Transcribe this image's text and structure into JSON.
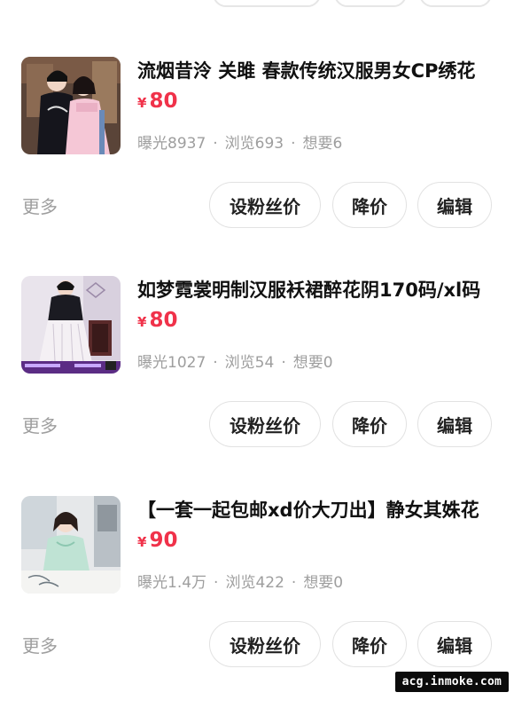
{
  "listings": [
    {
      "title": "流烟昔泠 关雎 春款传统汉服男女CP绣花",
      "currency": "¥",
      "price": "80",
      "stats": {
        "exposure": "曝光8937",
        "views": "浏览693",
        "wants": "想要6"
      },
      "more": "更多",
      "actions": {
        "fans_price": "设粉丝价",
        "price_cut": "降价",
        "edit": "编辑"
      }
    },
    {
      "title": "如梦霓裳明制汉服袄裙醉花阴170码/xl码",
      "currency": "¥",
      "price": "80",
      "stats": {
        "exposure": "曝光1027",
        "views": "浏览54",
        "wants": "想要0"
      },
      "more": "更多",
      "actions": {
        "fans_price": "设粉丝价",
        "price_cut": "降价",
        "edit": "编辑"
      }
    },
    {
      "title": "【一套一起包邮xd价大刀出】静女其姝花",
      "currency": "¥",
      "price": "90",
      "stats": {
        "exposure": "曝光1.4万",
        "views": "浏览422",
        "wants": "想要0"
      },
      "more": "更多",
      "actions": {
        "fans_price": "设粉丝价",
        "price_cut": "降价",
        "edit": "编辑"
      }
    }
  ],
  "stat_separator": "·",
  "watermark": "acg.inmoke.com",
  "colors": {
    "price": "#f0324a",
    "muted_text": "#9e9e9e",
    "button_border": "#e2e2e2"
  }
}
